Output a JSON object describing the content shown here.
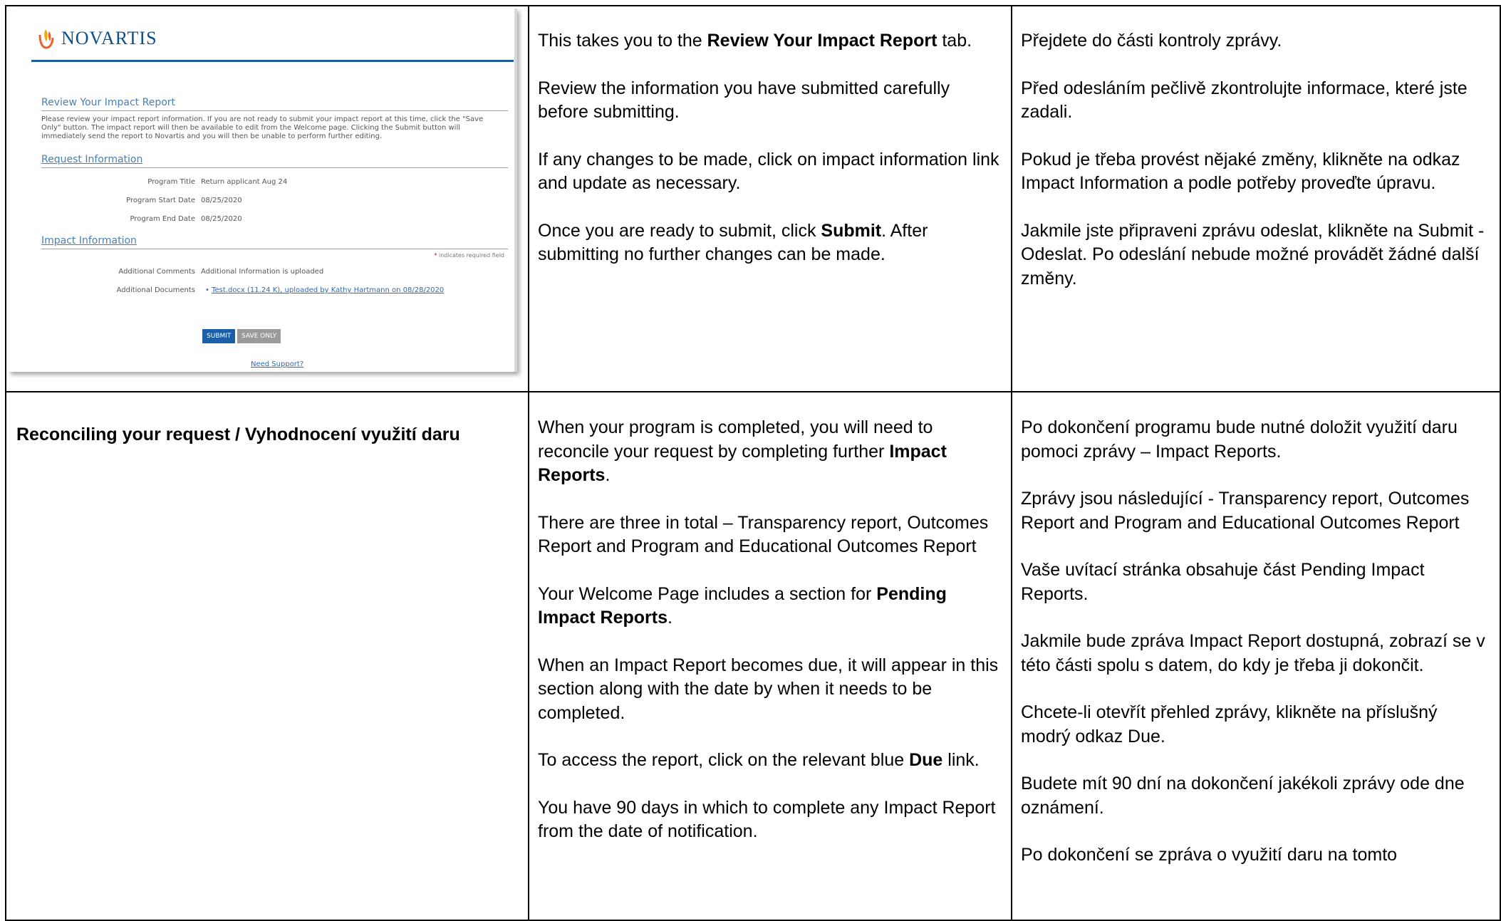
{
  "screenshot": {
    "brand": "NOVARTIS",
    "section_title": "Review Your Impact Report",
    "intro": "Please review your impact report information. If you are not ready to submit your impact report at this time, click the \"Save Only\" button. The impact report will then be available to edit from the Welcome page. Clicking the Submit button will immediately send the report to Novartis and you will then be unable to perform further editing.",
    "request_info_title": "Request Information",
    "program_title_label": "Program Title",
    "program_title_value": "Return applicant Aug 24",
    "program_start_label": "Program Start Date",
    "program_start_value": "08/25/2020",
    "program_end_label": "Program End Date",
    "program_end_value": "08/25/2020",
    "impact_info_title": "Impact Information",
    "required_note_star": "*",
    "required_note": "indicates required field",
    "additional_comments_label": "Additional Comments",
    "additional_comments_value": "Additional Information is uploaded",
    "additional_documents_label": "Additional Documents",
    "additional_document_link": "Test.docx (11.24 K), uploaded by Kathy Hartmann on 08/28/2020",
    "submit_button": "SUBMIT",
    "save_only_button": "SAVE ONLY",
    "support_link": "Need Support?"
  },
  "row1": {
    "en": {
      "p1_a": "This takes you to the ",
      "p1_b": "Review Your Impact Report",
      "p1_c": " tab.",
      "p2": "Review the information you have submitted carefully before submitting.",
      "p3": "If any changes to be made, click on impact information link and update as necessary.",
      "p4_a": "Once you are ready to submit, click ",
      "p4_b": "Submit",
      "p4_c": ". After submitting no further changes can be made."
    },
    "cz": {
      "p1": "Přejdete do části kontroly zprávy.",
      "p2": "Před odesláním pečlivě zkontrolujte informace, které jste zadali.",
      "p3": "Pokud je třeba provést nějaké změny, klikněte na odkaz Impact Information a podle potřeby proveďte úpravu.",
      "p4": "Jakmile jste připraveni zprávu odeslat, klikněte na Submit - Odeslat. Po odeslání nebude možné provádět žádné další změny."
    }
  },
  "row2": {
    "heading": "Reconciling your request / Vyhodnocení využití daru",
    "en": {
      "p1_a": "When your program is completed, you will need to reconcile your request by completing further ",
      "p1_b": "Impact Reports",
      "p1_c": ".",
      "p2": "There are three in total – Transparency report, Outcomes Report and Program and Educational Outcomes Report",
      "p3_a": "Your Welcome Page includes a section for ",
      "p3_b": "Pending Impact Reports",
      "p3_c": ".",
      "p4": "When an Impact Report becomes due, it will appear in this section along with the date by when it needs to be completed.",
      "p5_a": "To access the report, click on the relevant blue ",
      "p5_b": "Due",
      "p5_c": " link.",
      "p6": "You have 90 days in which to complete any Impact Report from the date of notification."
    },
    "cz": {
      "p1": "Po dokončení programu bude nutné doložit využití daru pomoci zprávy – Impact Reports.",
      "p2": "Zprávy jsou následující - Transparency report, Outcomes Report and Program and Educational Outcomes Report",
      "p3": "Vaše uvítací stránka obsahuje část Pending Impact Reports.",
      "p4": "Jakmile bude zpráva Impact Report dostupná, zobrazí se v této části spolu s datem, do kdy je třeba ji dokončit.",
      "p5": "Chcete-li otevřít přehled zprávy, klikněte na příslušný modrý odkaz Due.",
      "p6": "Budete mít 90 dní na dokončení jakékoli zprávy ode dne oznámení.",
      "p7": "Po dokončení se zpráva o využití daru na tomto"
    }
  },
  "colors": {
    "brand_blue": "#0b4f8e",
    "submit_blue": "#1c5fa6",
    "link_blue": "#2a6bb2"
  }
}
